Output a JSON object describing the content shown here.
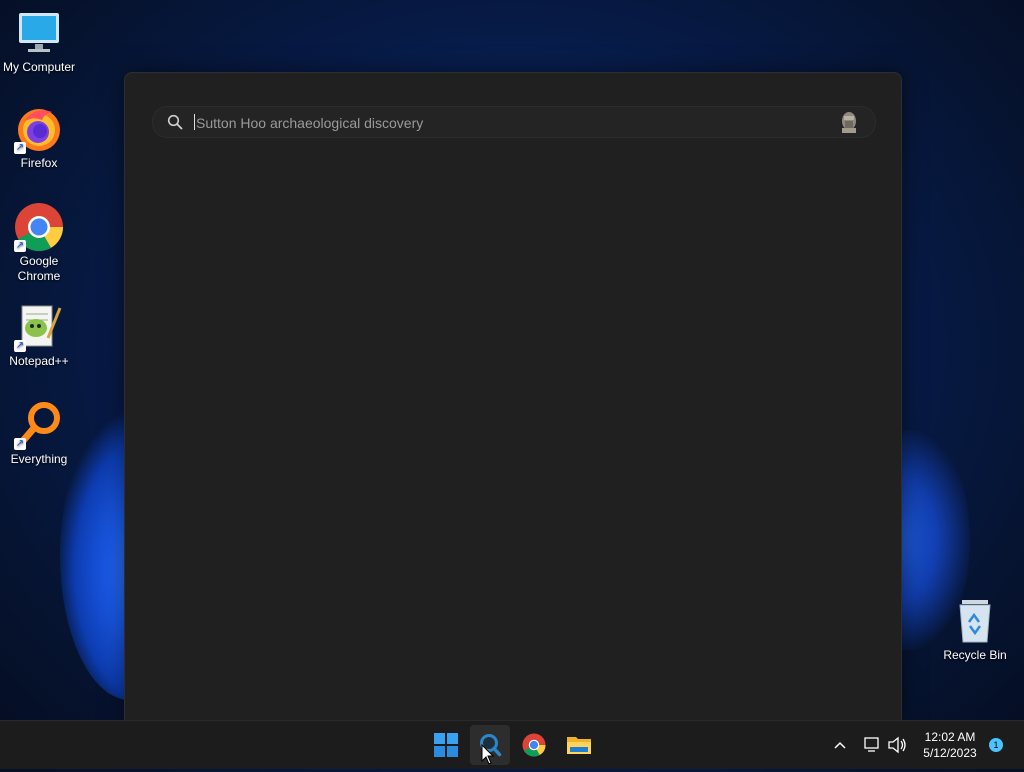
{
  "desktop": {
    "icons": [
      {
        "label": "My Computer"
      },
      {
        "label": "Firefox"
      },
      {
        "label": "Google Chrome"
      },
      {
        "label": "Notepad++"
      },
      {
        "label": "Everything"
      },
      {
        "label": "Recycle Bin"
      }
    ]
  },
  "search": {
    "placeholder": "Sutton Hoo archaeological discovery",
    "value": ""
  },
  "taskbar": {
    "time": "12:02 AM",
    "date": "5/12/2023",
    "notification_count": "1"
  },
  "colors": {
    "accent": "#4cc2ff",
    "panel": "#202020",
    "taskbar": "#1c1c1c"
  }
}
